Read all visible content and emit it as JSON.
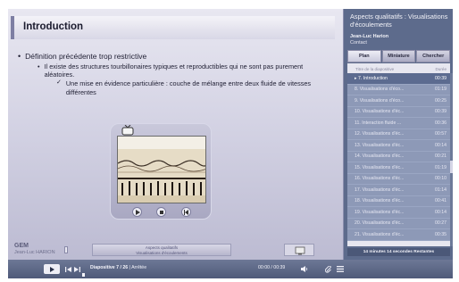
{
  "slide": {
    "title": "Introduction",
    "bullets": [
      {
        "level": 1,
        "text": "Définition précédente trop restrictive"
      },
      {
        "level": 2,
        "text": "Il existe des structures tourbillonaires typiques et reproductibles qui ne sont pas purement aléatoires."
      },
      {
        "level": 3,
        "text": "Une mise en évidence particulière : couche de mélange entre deux fluide de vitesses différentes"
      }
    ],
    "footer": {
      "logo": "GEM",
      "logo_sub": "Jean-Luc HARION",
      "center_line1": "Aspects qualitatifs",
      "center_line2": "Visualisations d'écoulements"
    }
  },
  "panel": {
    "title": "Aspects qualitatifs : Visualisations d'écoulements",
    "author": "Jean-Luc Harion",
    "contact": "Contact",
    "tabs": [
      "Plan",
      "Miniature",
      "Chercher"
    ],
    "list_headers": {
      "title": "Titre de la diapositive",
      "duration": "Durée"
    },
    "items": [
      {
        "label": "7. Introduction",
        "duration": "00:39",
        "current": true
      },
      {
        "label": "8. Visualisations d'éco...",
        "duration": "01:19"
      },
      {
        "label": "9. Visualisations d'éco...",
        "duration": "00:25"
      },
      {
        "label": "10. Visualisations d'éc...",
        "duration": "00:39"
      },
      {
        "label": "11. Interaction fluide ...",
        "duration": "00:36"
      },
      {
        "label": "12. Visualisations d'éc...",
        "duration": "00:57"
      },
      {
        "label": "13. Visualisations d'éc...",
        "duration": "00:14"
      },
      {
        "label": "14. Visualisations d'éc...",
        "duration": "00:21"
      },
      {
        "label": "15. Visualisations d'éc...",
        "duration": "01:19"
      },
      {
        "label": "16. Visualisations d'éc...",
        "duration": "00:10"
      },
      {
        "label": "17. Visualisations d'éc...",
        "duration": "01:14"
      },
      {
        "label": "18. Visualisations d'éc...",
        "duration": "00:41"
      },
      {
        "label": "19. Visualisations d'éc...",
        "duration": "00:14"
      },
      {
        "label": "20. Visualisations d'éc...",
        "duration": "00:27"
      },
      {
        "label": "21. Visualisations d'éc...",
        "duration": "00:35"
      }
    ],
    "status": "14 minutes 14 secondes Restantes"
  },
  "controls": {
    "play_icon": "play-icon",
    "slide_info": "Diapositive 7 / 26",
    "slide_state": "Arrêtée",
    "time": "00:00 / 00:39",
    "progress_fraction": 0.0
  },
  "colors": {
    "panel_bg": "#5d6b8c",
    "row_bg": "#8d99b7",
    "row_current": "#5c6b90",
    "slide_bg": "#d4d3e4"
  }
}
